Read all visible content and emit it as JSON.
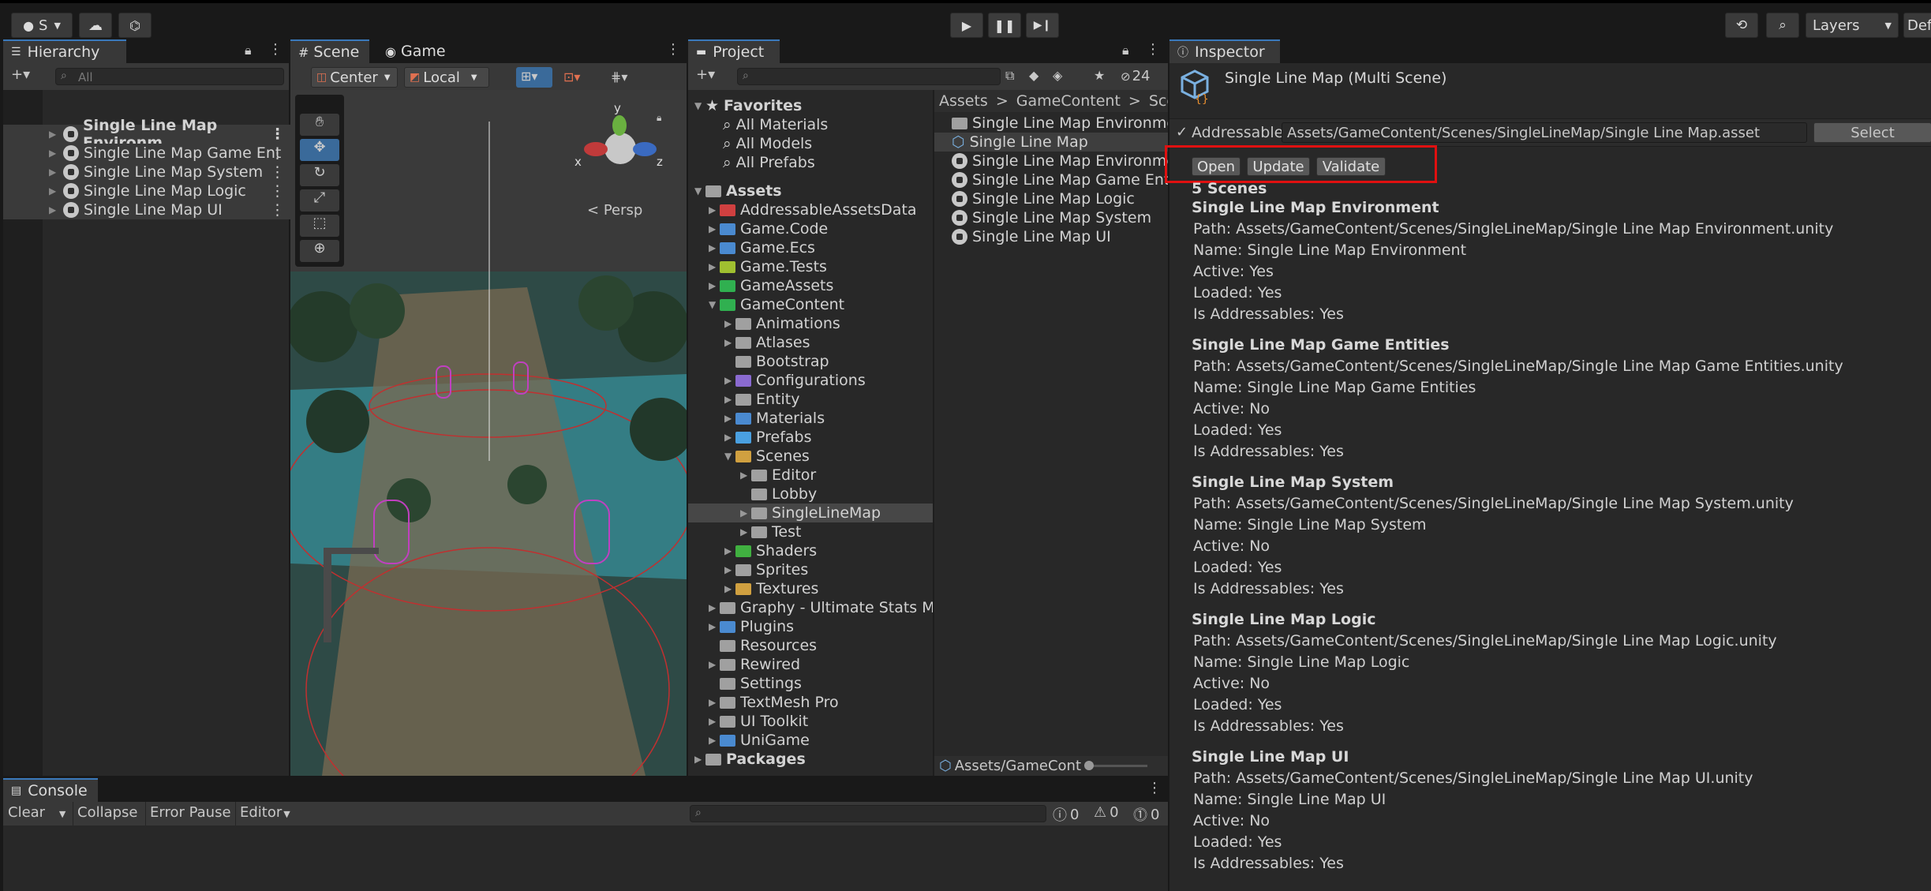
{
  "toolbar": {
    "account_label": "S",
    "layers_label": "Layers",
    "layout_label": "Def"
  },
  "hierarchy": {
    "tab": "Hierarchy",
    "search_placeholder": "All",
    "items": [
      {
        "label": "Single Line Map Environm"
      },
      {
        "label": "Single Line Map Game Ent"
      },
      {
        "label": "Single Line Map System"
      },
      {
        "label": "Single Line Map Logic"
      },
      {
        "label": "Single Line Map UI"
      }
    ]
  },
  "scene": {
    "tab_scene": "Scene",
    "tab_game": "Game",
    "pivot": "Center",
    "space": "Local",
    "persp": "Persp",
    "gizmo": {
      "x": "x",
      "y": "y",
      "z": "z"
    }
  },
  "project": {
    "tab": "Project",
    "hidden_count": "24",
    "favorites_label": "Favorites",
    "favorites": [
      "All Materials",
      "All Models",
      "All Prefabs"
    ],
    "assets_label": "Assets",
    "assets_folders": [
      "AddressableAssetsData",
      "Game.Code",
      "Game.Ecs",
      "Game.Tests",
      "GameAssets",
      "GameContent"
    ],
    "gamecontent_folders": [
      "Animations",
      "Atlases",
      "Bootstrap",
      "Configurations",
      "Entity",
      "Materials",
      "Prefabs",
      "Scenes"
    ],
    "scenes_folders": [
      "Editor",
      "Lobby",
      "SingleLineMap",
      "Test"
    ],
    "gamecontent_folders_after": [
      "Shaders",
      "Sprites",
      "Textures"
    ],
    "assets_folders_after": [
      "Graphy - Ultimate Stats Mo",
      "Plugins",
      "Resources",
      "Rewired",
      "Settings",
      "TextMesh Pro",
      "UI Toolkit",
      "UniGame"
    ],
    "packages_label": "Packages",
    "breadcrumb": [
      "Assets",
      ">",
      "GameContent",
      ">",
      "Scene"
    ],
    "files": [
      "Single Line Map Environmer",
      "Single Line Map",
      "Single Line Map Environme",
      "Single Line Map Game Entit",
      "Single Line Map Logic",
      "Single Line Map System",
      "Single Line Map UI"
    ],
    "footer_path": "Assets/GameCont"
  },
  "inspector": {
    "tab": "Inspector",
    "title": "Single Line Map (Multi Scene)",
    "addressable_label": "Addressable",
    "addressable_path": "Assets/GameContent/Scenes/SingleLineMap/Single Line Map.asset",
    "select_label": "Select",
    "buttons": {
      "open": "Open",
      "update": "Update",
      "validate": "Validate"
    },
    "scene_count": "5 Scenes",
    "scenes": [
      {
        "name": "Single Line Map Environment",
        "path": "Path: Assets/GameContent/Scenes/SingleLineMap/Single Line Map Environment.unity",
        "name_line": "Name: Single Line Map Environment",
        "active": "Active: Yes",
        "loaded": "Loaded: Yes",
        "addr": "Is Addressables: Yes"
      },
      {
        "name": "Single Line Map Game Entities",
        "path": "Path: Assets/GameContent/Scenes/SingleLineMap/Single Line Map Game Entities.unity",
        "name_line": "Name: Single Line Map Game Entities",
        "active": "Active: No",
        "loaded": "Loaded: Yes",
        "addr": "Is Addressables: Yes"
      },
      {
        "name": "Single Line Map System",
        "path": "Path: Assets/GameContent/Scenes/SingleLineMap/Single Line Map System.unity",
        "name_line": "Name: Single Line Map System",
        "active": "Active: No",
        "loaded": "Loaded: Yes",
        "addr": "Is Addressables: Yes"
      },
      {
        "name": "Single Line Map Logic",
        "path": "Path: Assets/GameContent/Scenes/SingleLineMap/Single Line Map Logic.unity",
        "name_line": "Name: Single Line Map Logic",
        "active": "Active: No",
        "loaded": "Loaded: Yes",
        "addr": "Is Addressables: Yes"
      },
      {
        "name": "Single Line Map UI",
        "path": "Path: Assets/GameContent/Scenes/SingleLineMap/Single Line Map UI.unity",
        "name_line": "Name: Single Line Map UI",
        "active": "Active: No",
        "loaded": "Loaded: Yes",
        "addr": "Is Addressables: Yes"
      }
    ]
  },
  "console": {
    "tab": "Console",
    "clear": "Clear",
    "collapse": "Collapse",
    "error_pause": "Error Pause",
    "editor": "Editor",
    "info_count": "0",
    "warn_count": "0",
    "error_count": "0"
  },
  "colors": {
    "accent": "#3a79bb",
    "highlight_box": "#e01010",
    "selection": "#2c5d87"
  }
}
